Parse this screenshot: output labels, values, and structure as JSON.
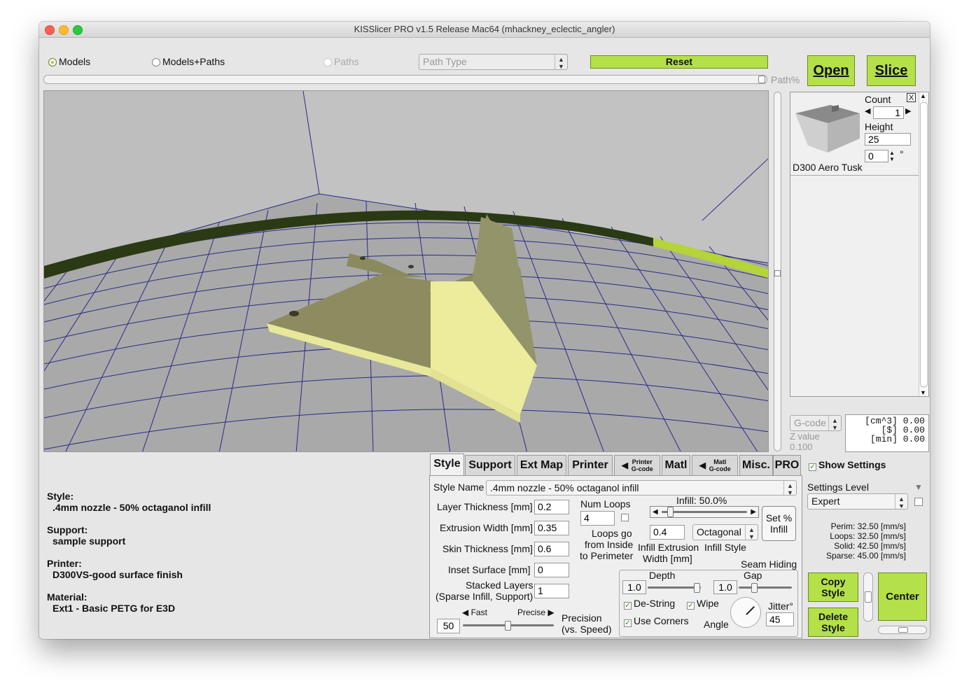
{
  "window": {
    "title": "KISSlicer PRO v1.5 Release Mac64 (mhackney_eclectic_angler)"
  },
  "view_modes": {
    "models": "Models",
    "models_paths": "Models+Paths",
    "paths": "Paths"
  },
  "path_type": {
    "value": "Path Type"
  },
  "buttons": {
    "reset": "Reset",
    "open": "Open",
    "slice": "Slice",
    "copy_style": "Copy Style",
    "delete_style": "Delete Style",
    "center": "Center",
    "set_infill": "Set % Infill",
    "close": "X"
  },
  "path_percent_label": "Path%",
  "model_panel": {
    "name": "D300 Aero Tusk",
    "count_label": "Count",
    "count": "1",
    "height_label": "Height",
    "height": "25",
    "angle": "0",
    "angle_unit": "°"
  },
  "gcode": {
    "value": "G-code",
    "z_label": "Z value",
    "z_value": "0.100"
  },
  "stats": {
    "line1": "[cm^3] 0.00",
    "line2": "[$] 0.00",
    "line3": "[min] 0.00"
  },
  "summary": {
    "style_label": "Style:",
    "style_value": ".4mm nozzle - 50% octaganol infill",
    "support_label": "Support:",
    "support_value": "sample support",
    "printer_label": "Printer:",
    "printer_value": "D300VS-good surface finish",
    "material_label": "Material:",
    "material_value": "Ext1 - Basic PETG for E3D"
  },
  "tabs": {
    "style": "Style",
    "support": "Support",
    "ext_map": "Ext Map",
    "printer": "Printer",
    "printer_gcode_1": "Printer",
    "printer_gcode_2": "G-code",
    "matl": "Matl",
    "matl_gcode_1": "Matl",
    "matl_gcode_2": "G-code",
    "misc": "Misc.",
    "pro": "PRO"
  },
  "style_panel": {
    "style_name_label": "Style Name",
    "style_name_value": ".4mm nozzle - 50% octaganol infill",
    "layer_thickness_label": "Layer Thickness [mm]",
    "layer_thickness": "0.2",
    "extrusion_width_label": "Extrusion Width [mm]",
    "extrusion_width": "0.35",
    "skin_thickness_label": "Skin Thickness [mm]",
    "skin_thickness": "0.6",
    "inset_surface_label": "Inset  Surface [mm]",
    "inset_surface": "0",
    "stacked_layers_label_1": "Stacked Layers",
    "stacked_layers_label_2": "(Sparse Infill, Support)",
    "stacked_layers": "1",
    "num_loops_label": "Num Loops",
    "num_loops": "4",
    "loops_go_1": "Loops go",
    "loops_go_2": "from Inside",
    "loops_go_3": "to Perimeter",
    "infill_label": "Infill: 50.0%",
    "infill_width": "0.4",
    "infill_style": "Octagonal",
    "infill_ext_label_1": "Infill Extrusion",
    "infill_ext_label_2": "Width [mm]",
    "infill_style_label": "Infill Style",
    "fast_label": "Fast",
    "precise_label": "Precise",
    "precision_value": "50",
    "precision_label_1": "Precision",
    "precision_label_2": "(vs. Speed)",
    "seam_hiding_label": "Seam Hiding",
    "depth_label": "Depth",
    "depth": "1.0",
    "gap_label": "Gap",
    "gap": "1.0",
    "destring_label": "De-String",
    "wipe_label": "Wipe",
    "use_corners_label": "Use Corners",
    "angle_label": "Angle",
    "jitter_label": "Jitter°",
    "jitter": "45"
  },
  "settings": {
    "show_settings_label": "Show Settings",
    "level_label": "Settings Level",
    "level_value": "Expert",
    "perim": "Perim:  32.50 [mm/s]",
    "loops": "Loops:  32.50 [mm/s]",
    "solid": "Solid:  42.50 [mm/s]",
    "sparse": "Sparse: 45.00 [mm/s]"
  },
  "colors": {
    "accent_green": "#b4e04a",
    "model_top": "#8c8c60",
    "model_side": "#ecec9c",
    "viewport_bg": "#b9b9b9"
  }
}
